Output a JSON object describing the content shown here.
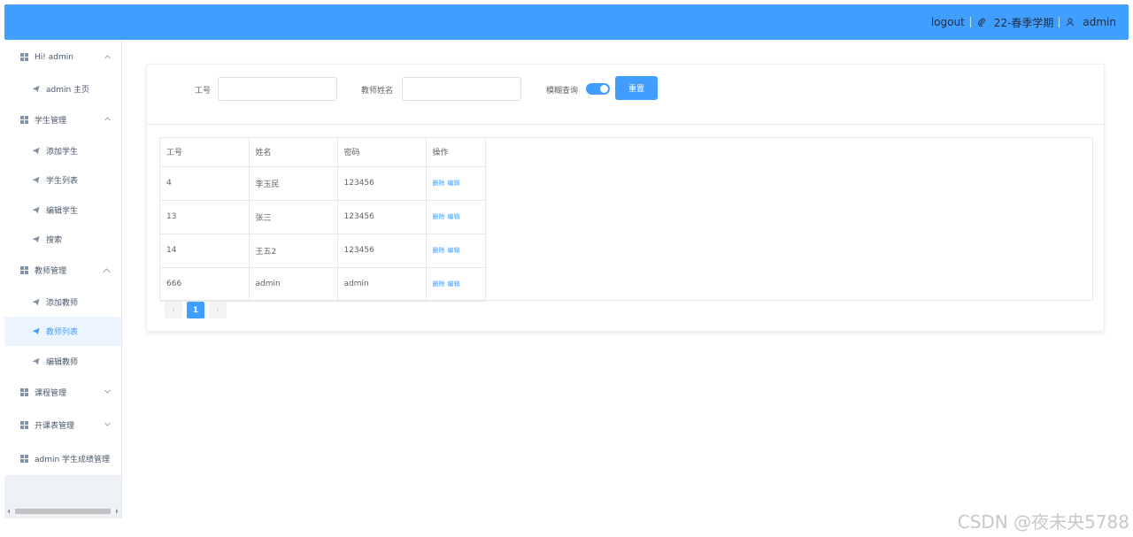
{
  "header": {
    "logout": "logout",
    "term": "22-春季学期",
    "user": "admin"
  },
  "sidebar": {
    "items": [
      {
        "label": "Hi! admin",
        "type": "group",
        "chevron": "up"
      },
      {
        "label": "admin 主页",
        "type": "sub"
      },
      {
        "label": "学生管理",
        "type": "group",
        "chevron": "up"
      },
      {
        "label": "添加学生",
        "type": "sub"
      },
      {
        "label": "学生列表",
        "type": "sub"
      },
      {
        "label": "编辑学生",
        "type": "sub"
      },
      {
        "label": "搜索",
        "type": "sub"
      },
      {
        "label": "教师管理",
        "type": "group",
        "chevron": "up"
      },
      {
        "label": "添加教师",
        "type": "sub"
      },
      {
        "label": "教师列表",
        "type": "sub",
        "active": true
      },
      {
        "label": "编辑教师",
        "type": "sub"
      },
      {
        "label": "课程管理",
        "type": "group",
        "chevron": "down"
      },
      {
        "label": "开课表管理",
        "type": "group",
        "chevron": "down"
      },
      {
        "label": "admin 学生成绩管理",
        "type": "group"
      }
    ]
  },
  "search": {
    "id_label": "工号",
    "id_value": "",
    "name_label": "教师姓名",
    "name_value": "",
    "fuzzy_label": "模糊查询",
    "fuzzy_on": true,
    "reset_label": "重置"
  },
  "table": {
    "columns": [
      "工号",
      "姓名",
      "密码",
      "操作"
    ],
    "rows": [
      {
        "id": "4",
        "name": "李玉民",
        "password": "123456",
        "delete": "删除",
        "edit": "编辑"
      },
      {
        "id": "13",
        "name": "张三",
        "password": "123456",
        "delete": "删除",
        "edit": "编辑"
      },
      {
        "id": "14",
        "name": "王五2",
        "password": "123456",
        "delete": "删除",
        "edit": "编辑"
      },
      {
        "id": "666",
        "name": "admin",
        "password": "admin",
        "delete": "删除",
        "edit": "编辑"
      }
    ]
  },
  "pagination": {
    "prev": "‹",
    "current": "1",
    "next": "›"
  },
  "watermark": "CSDN @夜未央5788",
  "colors": {
    "primary": "#409eff",
    "sidebar_bg": "#eef1f6",
    "active_bg": "#ecf5ff"
  }
}
